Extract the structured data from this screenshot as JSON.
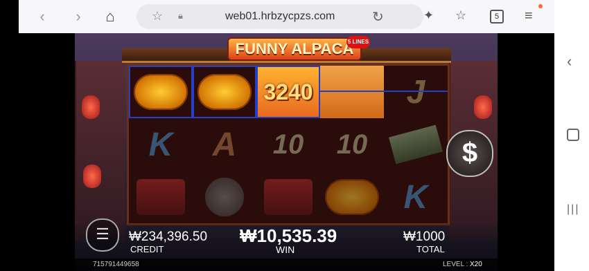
{
  "browser": {
    "url": "web01.hrbzycpzs.com",
    "tab_count": "5"
  },
  "game": {
    "title": "FUNNY ALPACA",
    "lines_badge": "5 LINES",
    "win_symbol_amount": "3240",
    "credit_value": "₩234,396.50",
    "credit_label": "CREDIT",
    "win_value": "₩10,535.39",
    "win_label": "WIN",
    "total_value": "₩1000",
    "total_label": "TOTAL",
    "round_id": "715791449658",
    "level_label": "LEVEL :",
    "level_value": "X20",
    "spin_symbol": "$"
  },
  "reels": [
    [
      "lantern",
      "K",
      "firecracker"
    ],
    [
      "lantern",
      "A",
      "gong"
    ],
    [
      "alpaca-gold",
      "10",
      "firecracker"
    ],
    [
      "pagoda",
      "10",
      "lantern"
    ],
    [
      "J",
      "money",
      "K"
    ]
  ]
}
